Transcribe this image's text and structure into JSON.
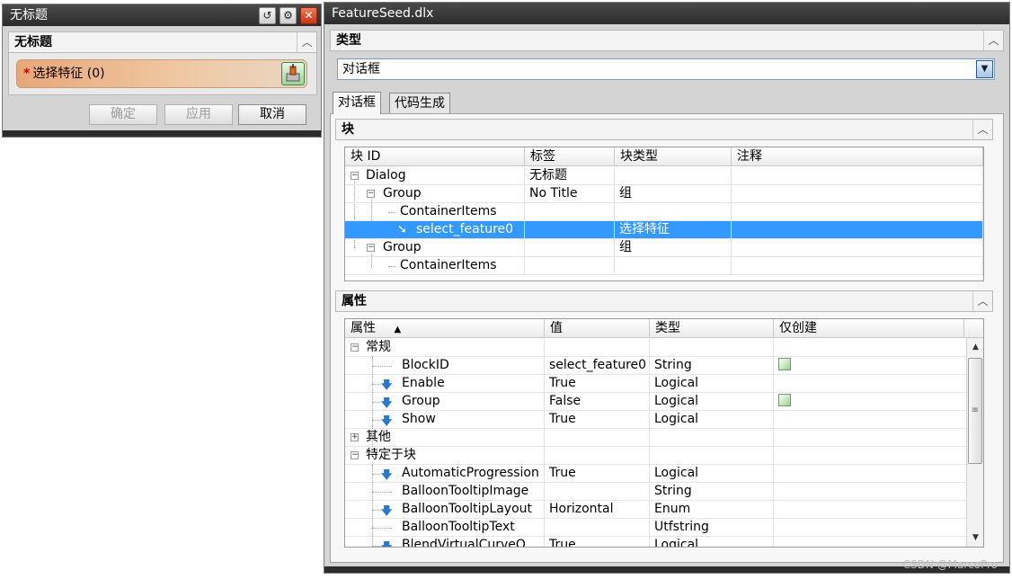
{
  "left_dialog": {
    "title": "无标题",
    "section": "无标题",
    "select_required": "*",
    "select_label": "选择特征 (0)",
    "ok": "确定",
    "apply": "应用",
    "cancel": "取消"
  },
  "right_dialog": {
    "title": "FeatureSeed.dlx",
    "type_section": "类型",
    "type_value": "对话框",
    "tabs": [
      "对话框",
      "代码生成"
    ],
    "block_section": "块",
    "block_columns": [
      "块 ID",
      "标签",
      "块类型",
      "注释"
    ],
    "block_rows": [
      {
        "id": "Dialog",
        "label": "无标题",
        "type": "",
        "note": ""
      },
      {
        "id": "Group",
        "label": "No Title",
        "type": "组",
        "note": ""
      },
      {
        "id": "ContainerItems",
        "label": "",
        "type": "",
        "note": ""
      },
      {
        "id": "select_feature0",
        "label": "",
        "type": "选择特征",
        "note": ""
      },
      {
        "id": "Group",
        "label": "",
        "type": "组",
        "note": ""
      },
      {
        "id": "ContainerItems",
        "label": "",
        "type": "",
        "note": ""
      }
    ],
    "props_section": "属性",
    "props_columns": [
      "属性",
      "值",
      "类型",
      "仅创建"
    ],
    "props_sort_indicator": "▲",
    "props_rows": [
      {
        "name": "常规",
        "value": "",
        "type": "",
        "create_only": false
      },
      {
        "name": "BlockID",
        "value": "select_feature0",
        "type": "String",
        "create_only": true
      },
      {
        "name": "Enable",
        "value": "True",
        "type": "Logical",
        "create_only": false
      },
      {
        "name": "Group",
        "value": "False",
        "type": "Logical",
        "create_only": true
      },
      {
        "name": "Show",
        "value": "True",
        "type": "Logical",
        "create_only": false
      },
      {
        "name": "其他",
        "value": "",
        "type": "",
        "create_only": false
      },
      {
        "name": "特定于块",
        "value": "",
        "type": "",
        "create_only": false
      },
      {
        "name": "AutomaticProgression",
        "value": "True",
        "type": "Logical",
        "create_only": false
      },
      {
        "name": "BalloonTooltipImage",
        "value": "",
        "type": "String",
        "create_only": false
      },
      {
        "name": "BalloonTooltipLayout",
        "value": "Horizontal",
        "type": "Enum",
        "create_only": false
      },
      {
        "name": "BalloonTooltipText",
        "value": "",
        "type": "Utfstring",
        "create_only": false
      },
      {
        "name": "BlendVirtualCurveO",
        "value": "True",
        "type": "Logical",
        "create_only": false
      }
    ]
  },
  "watermark": "CSDN @MarcoPro",
  "colors": {
    "selection": "#3399ff",
    "titlebar": "#2c2c2c",
    "required_star": "#d00000",
    "select_pill": "#e8a779"
  }
}
